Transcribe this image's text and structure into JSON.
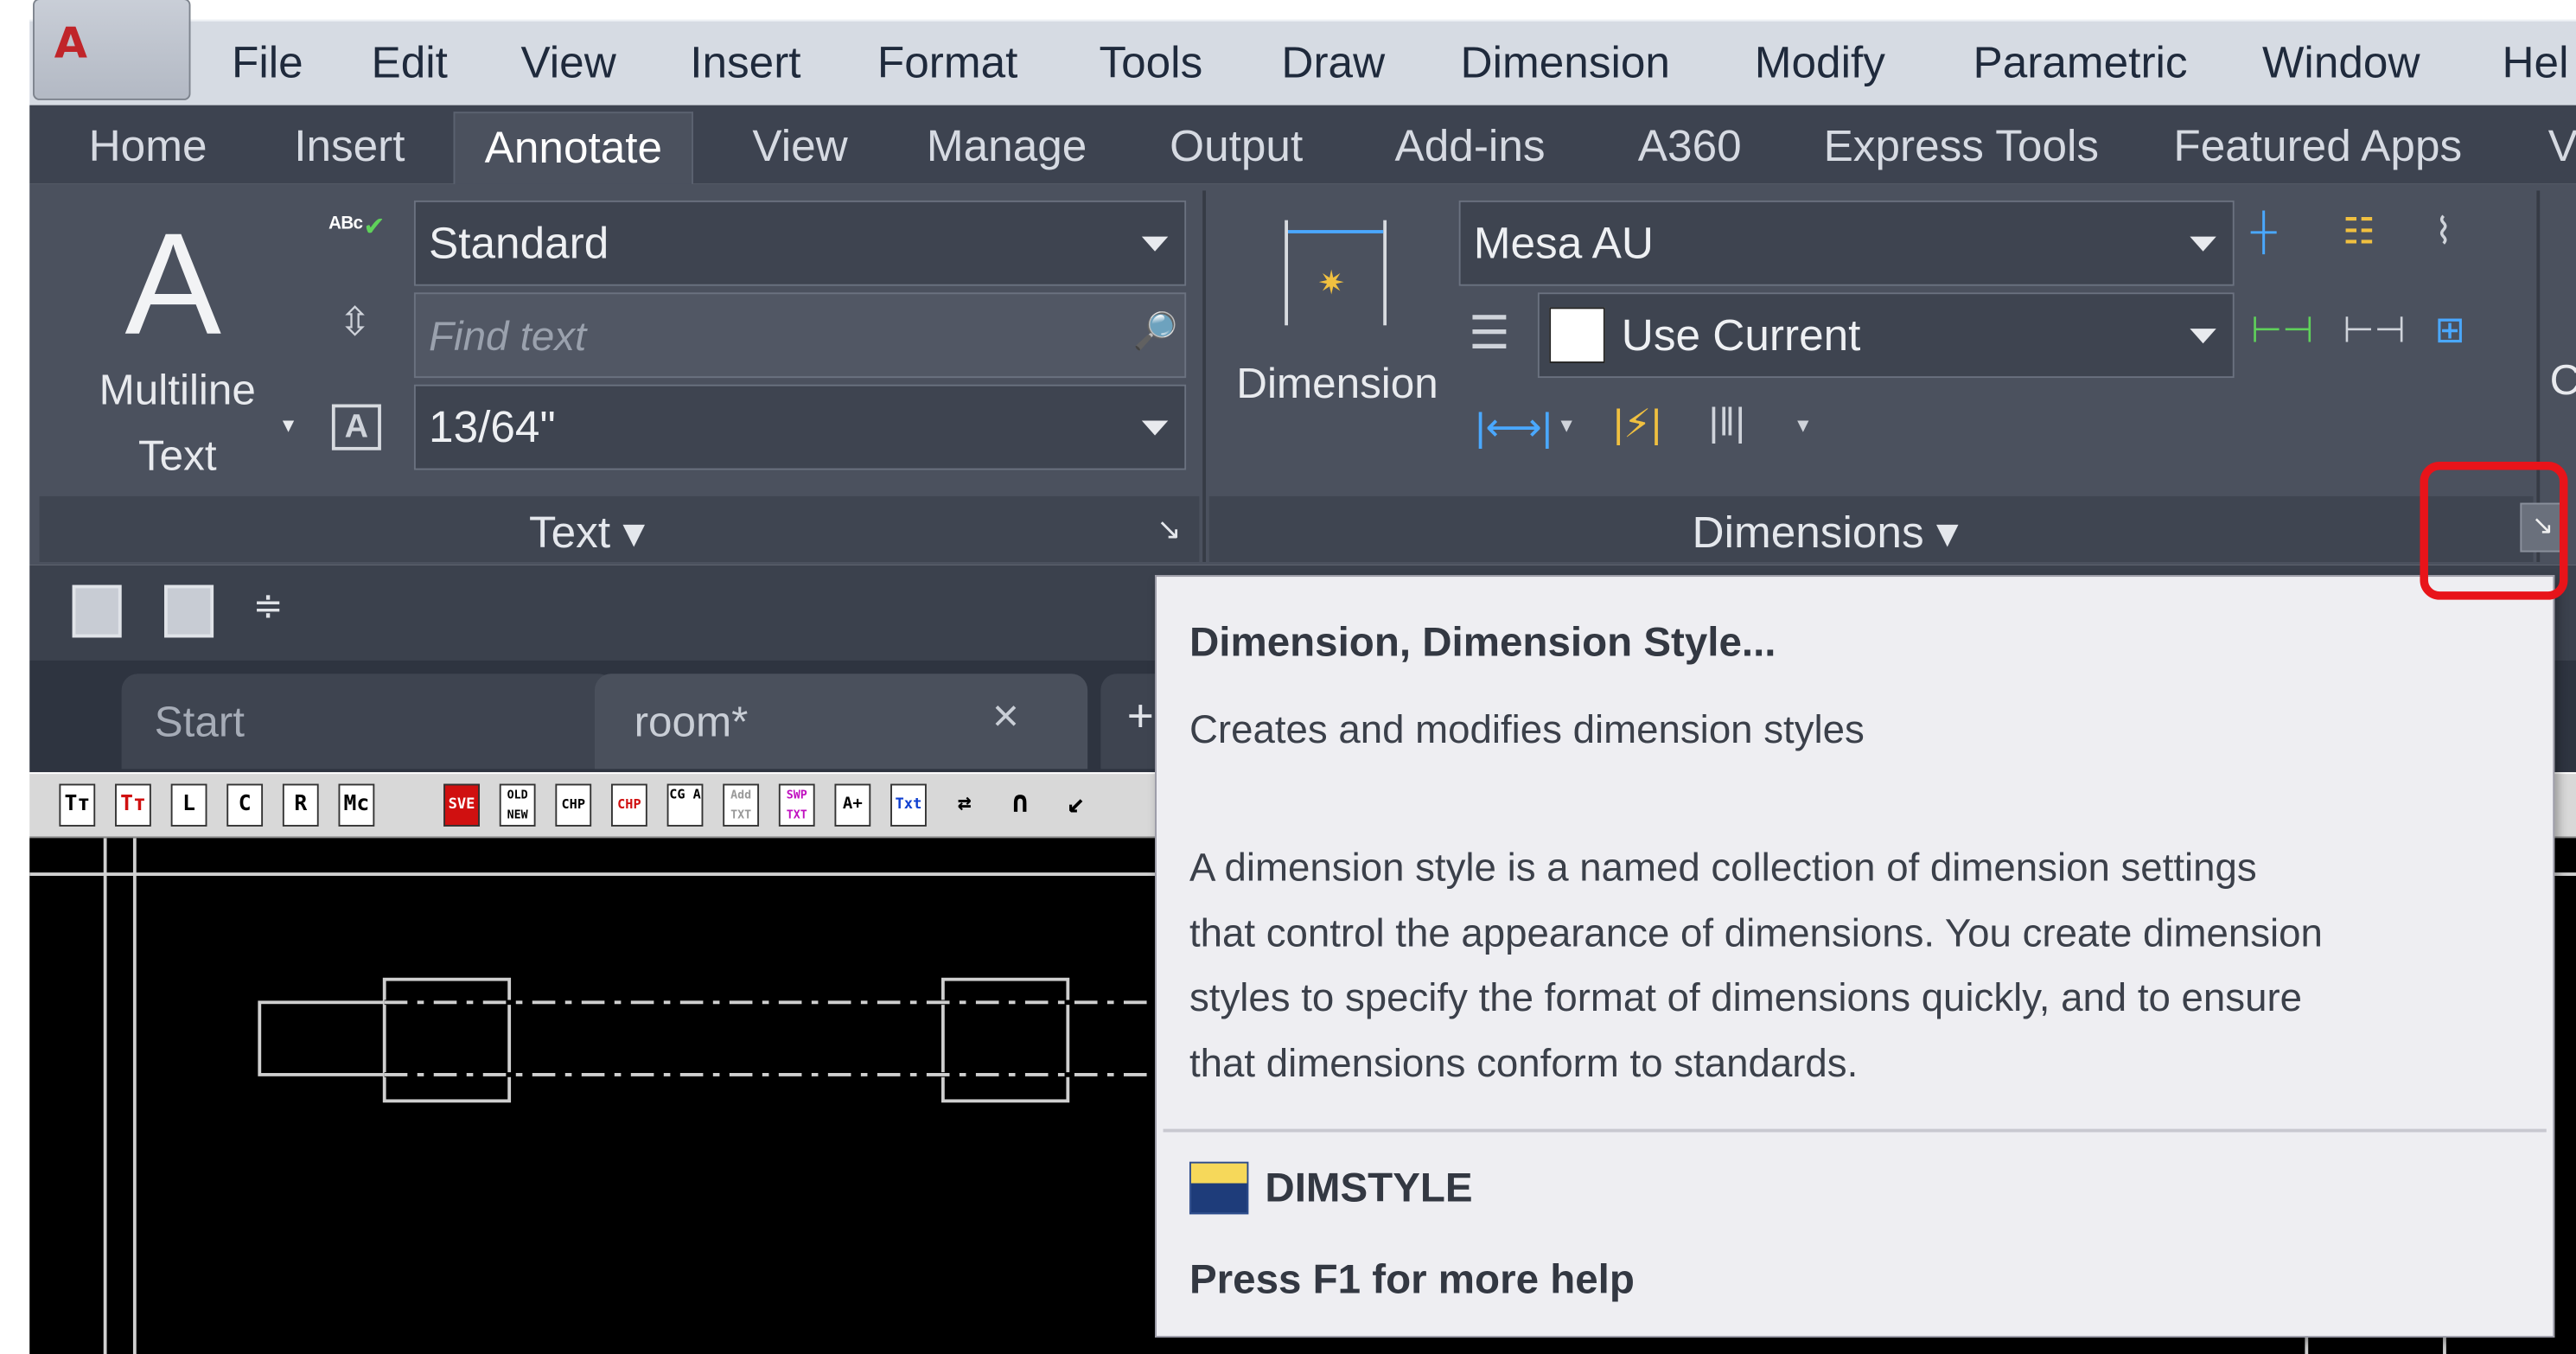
{
  "menu": {
    "items": [
      "File",
      "Edit",
      "View",
      "Insert",
      "Format",
      "Tools",
      "Draw",
      "Dimension",
      "Modify",
      "Parametric",
      "Window",
      "Hel"
    ]
  },
  "ribbon_tabs": [
    "Home",
    "Insert",
    "Annotate",
    "View",
    "Manage",
    "Output",
    "Add-ins",
    "A360",
    "Express Tools",
    "Featured Apps",
    "V"
  ],
  "active_tab": "Annotate",
  "text_panel": {
    "multiline_line1": "Multiline",
    "multiline_line2": "Text",
    "text_style": "Standard",
    "find_placeholder": "Find text",
    "text_height": "13/64\"",
    "title": "Text"
  },
  "dimensions_panel": {
    "button_label": "Dimension",
    "dim_style": "Mesa AU",
    "layer": "Use Current",
    "title": "Dimensions",
    "partial_next": "C"
  },
  "file_tabs": {
    "start": "Start",
    "room": "room*",
    "close": "×",
    "new": "+"
  },
  "tooltip": {
    "title": "Dimension, Dimension Style...",
    "subtitle": "Creates and modifies dimension styles",
    "body_lines": [
      "A dimension style is a named collection of dimension settings",
      "that control the appearance of dimensions. You create dimension",
      "styles to specify the format of dimensions quickly, and to ensure",
      "that dimensions conform to standards."
    ],
    "command": "DIMSTYLE",
    "help": "Press F1 for more help"
  },
  "toolbar_icons": [
    "Tт",
    "Tт",
    "L",
    "C",
    "R",
    "Mc",
    "SVE",
    "OLD NEW",
    "CHP",
    "CHP",
    "CG A",
    "Add TXT",
    "SWP TXT",
    "A+",
    "Txt",
    "⇄",
    "∩",
    "↙"
  ],
  "colors": {
    "menubar": "#d6dbe3",
    "ribbon": "#4b515e",
    "ribbon_tabs": "#3d4350",
    "tooltip_bg": "#eeeef2",
    "highlight": "#e8141a",
    "drawing_bg": "#000000"
  }
}
